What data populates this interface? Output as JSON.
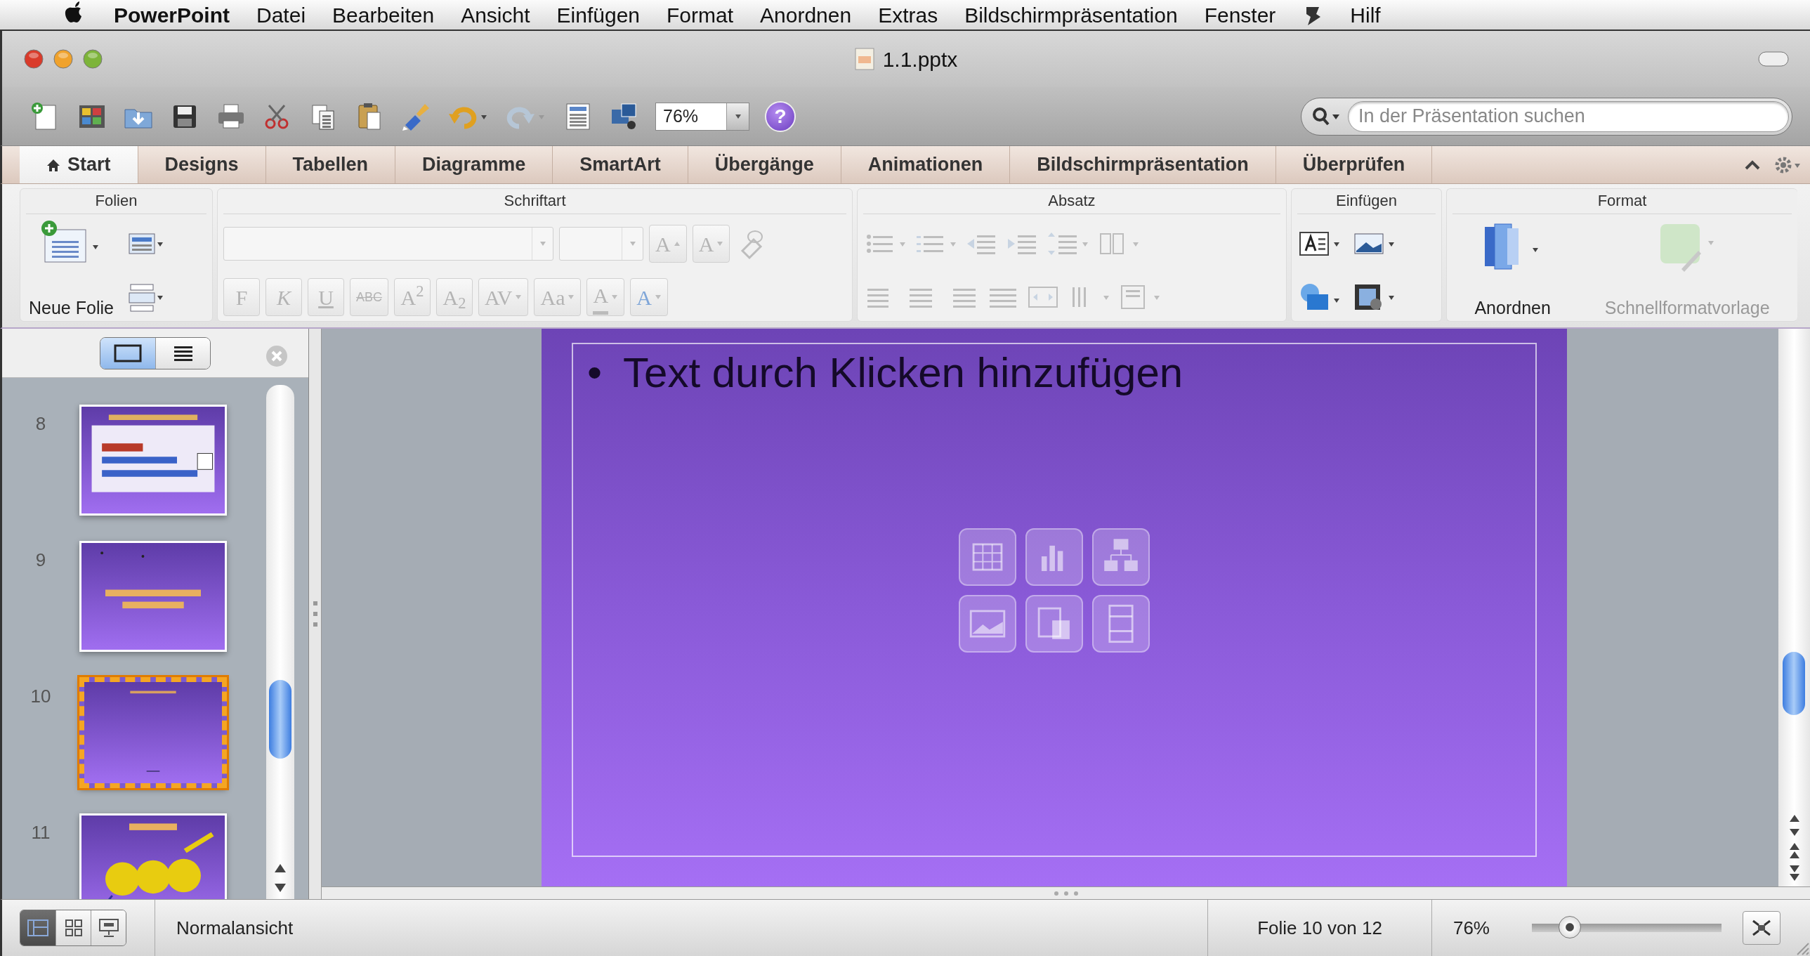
{
  "menubar": {
    "app": "PowerPoint",
    "items": [
      {
        "kind": "text",
        "label": "Datei"
      },
      {
        "kind": "text",
        "label": "Bearbeiten"
      },
      {
        "kind": "text",
        "label": "Ansicht"
      },
      {
        "kind": "text",
        "label": "Einfügen"
      },
      {
        "kind": "text",
        "label": "Format"
      },
      {
        "kind": "text",
        "label": "Anordnen"
      },
      {
        "kind": "text",
        "label": "Extras"
      },
      {
        "kind": "text",
        "label": "Bildschirmpräsentation"
      },
      {
        "kind": "text",
        "label": "Fenster"
      },
      {
        "kind": "icon"
      },
      {
        "kind": "text",
        "label": "Hilf"
      }
    ]
  },
  "window": {
    "title": "1.1.pptx"
  },
  "toolbar": {
    "zoom": "76%",
    "help": "?",
    "search": {
      "placeholder": "In der Präsentation suchen"
    }
  },
  "ribbon_tabs": [
    {
      "label": "Start",
      "selected": true
    },
    {
      "label": "Designs",
      "selected": false
    },
    {
      "label": "Tabellen",
      "selected": false
    },
    {
      "label": "Diagramme",
      "selected": false
    },
    {
      "label": "SmartArt",
      "selected": false
    },
    {
      "label": "Übergänge",
      "selected": false
    },
    {
      "label": "Animationen",
      "selected": false
    },
    {
      "label": "Bildschirmpräsentation",
      "selected": false
    },
    {
      "label": "Überprüfen",
      "selected": false
    }
  ],
  "ribbon": {
    "groups": [
      {
        "title": "Folien",
        "kind": "slides",
        "label": "Neue Folie"
      },
      {
        "title": "Schriftart",
        "kind": "font",
        "disabled": true,
        "top_buttons": [
          {
            "label": "A",
            "kind": "grow"
          },
          {
            "label": "A",
            "kind": "shrink"
          }
        ],
        "format_buttons": [
          {
            "label": "F",
            "kind": "bold"
          },
          {
            "label": "K",
            "kind": "italic"
          },
          {
            "label": "U",
            "kind": "underline"
          },
          {
            "label": "ABC",
            "kind": "strike"
          },
          {
            "label": "A$^{2}$",
            "kind": "plain"
          },
          {
            "label": "A$_{2}$",
            "kind": "plain"
          },
          {
            "label": "AV",
            "kind": "spacing"
          },
          {
            "label": "Aa",
            "kind": "case"
          },
          {
            "label": "A",
            "kind": "color"
          },
          {
            "label": "A",
            "kind": "glow"
          }
        ]
      },
      {
        "title": "Absatz",
        "kind": "paragraph",
        "disabled": true
      },
      {
        "title": "Einfügen",
        "kind": "insert"
      },
      {
        "title": "Format",
        "kind": "format",
        "items": [
          {
            "label": "Anordnen",
            "disabled": false
          },
          {
            "label": "Schnellformatvorlage",
            "disabled": true
          }
        ]
      }
    ]
  },
  "sidebar": {
    "view_toggle": [
      {
        "kind": "slides",
        "selected": true
      },
      {
        "kind": "outline",
        "selected": false
      }
    ],
    "slides": [
      {
        "number": "8",
        "selected": false
      },
      {
        "number": "9",
        "selected": false
      },
      {
        "number": "10",
        "selected": true
      },
      {
        "number": "11",
        "selected": false
      }
    ]
  },
  "slide": {
    "bullets": [
      {
        "marker": "•",
        "text": "Text durch Klicken hinzufügen"
      }
    ]
  },
  "status_bar": {
    "views": [
      {
        "kind": "normal",
        "selected": true
      },
      {
        "kind": "sorter",
        "selected": false
      },
      {
        "kind": "show",
        "selected": false
      }
    ],
    "view_name": "Normalansicht",
    "position": "Folie 10 von 12",
    "zoom": "76%",
    "zoom_slider": {
      "level": 0.2
    }
  }
}
